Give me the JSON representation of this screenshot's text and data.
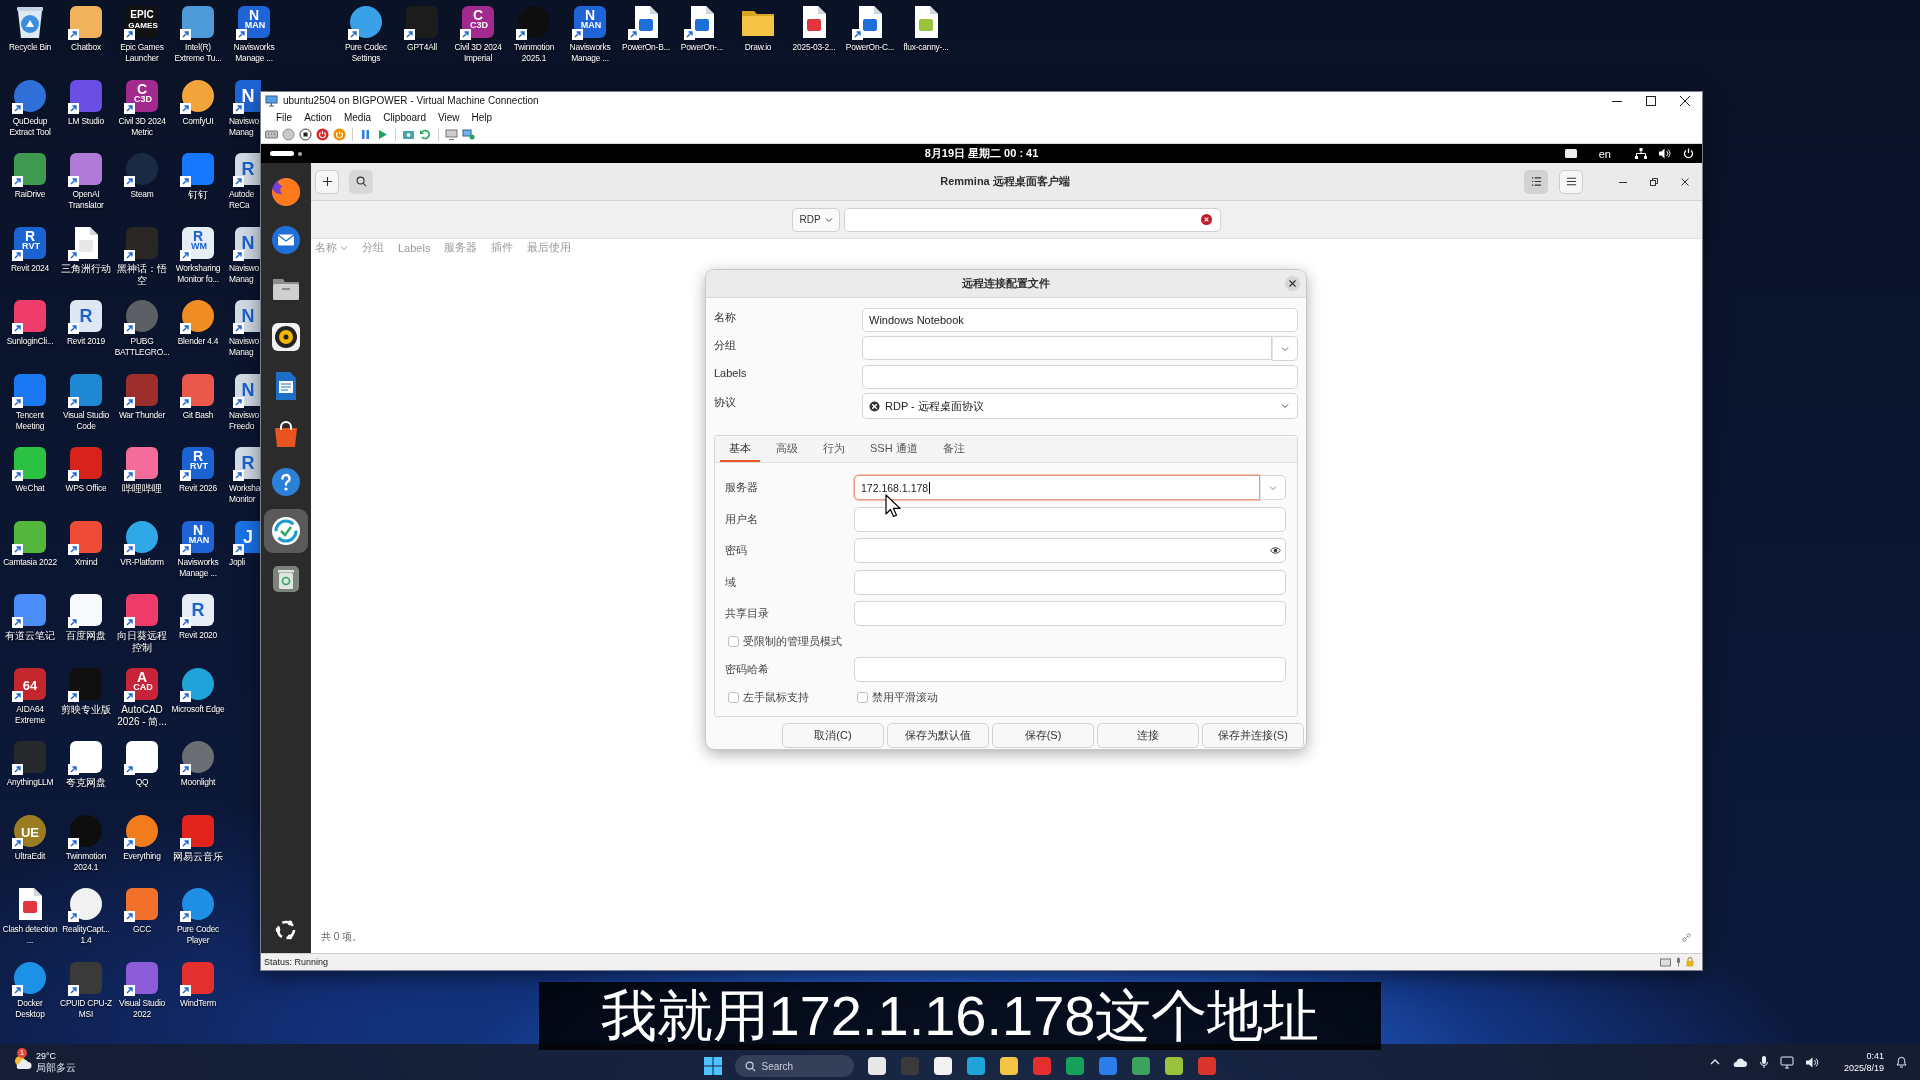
{
  "desktop": {
    "columns": [
      [
        {
          "label": "Recycle Bin",
          "kind": "bin",
          "color": "#3d8ee0",
          "shortcut": false
        },
        {
          "label": "QuDedup Extract Tool",
          "kind": "round",
          "color": "#2f6fd8",
          "shortcut": true
        },
        {
          "label": "RaiDrive",
          "kind": "tile",
          "color": "#3d9a4f",
          "shortcut": true
        },
        {
          "label": "Revit 2024",
          "kind": "tile",
          "color": "#1b63d1",
          "glyph": "R",
          "sub": "RVT",
          "shortcut": true
        },
        {
          "label": "SunloginCli...",
          "kind": "tile",
          "color": "#ef3d6b",
          "shortcut": true
        },
        {
          "label": "Tencent Meeting",
          "kind": "tile",
          "color": "#1a79f2",
          "shortcut": true
        },
        {
          "label": "WeChat",
          "kind": "tile",
          "color": "#2bc244",
          "shortcut": true
        },
        {
          "label": "Camtasia 2022",
          "kind": "tile",
          "color": "#55b63e",
          "shortcut": true
        },
        {
          "label": "有道云笔记",
          "kind": "tile",
          "color": "#4b8df8",
          "shortcut": true
        },
        {
          "label": "AIDA64 Extreme",
          "kind": "tile",
          "color": "#c4262e",
          "glyph": "64",
          "shortcut": true
        },
        {
          "label": "AnythingLLM",
          "kind": "tile",
          "color": "#26282c",
          "shortcut": true
        },
        {
          "label": "UltraEdit",
          "kind": "round",
          "color": "#9a7d22",
          "glyph": "UE",
          "shortcut": true
        },
        {
          "label": "Clash detection ...",
          "kind": "doc",
          "color": "#e2353f",
          "shortcut": false
        },
        {
          "label": "Docker Desktop",
          "kind": "round",
          "color": "#1d91e6",
          "shortcut": true
        }
      ],
      [
        {
          "label": "Chatbox",
          "kind": "tile",
          "color": "#f2b35e",
          "shortcut": true
        },
        {
          "label": "LM Studio",
          "kind": "tile",
          "color": "#6a4de3",
          "shortcut": true
        },
        {
          "label": "OpenAI Translator",
          "kind": "tile",
          "color": "#b07ad8",
          "shortcut": true
        },
        {
          "label": "三角洲行动",
          "kind": "doc",
          "color": "#e8e8e8",
          "shortcut": true
        },
        {
          "label": "Revit 2019",
          "kind": "tile",
          "color": "#dfe8f2",
          "glyph": "R",
          "shortcut": true
        },
        {
          "label": "Visual Studio Code",
          "kind": "tile",
          "color": "#1e88d4",
          "shortcut": true
        },
        {
          "label": "WPS Office",
          "kind": "tile",
          "color": "#d8231c",
          "shortcut": true
        },
        {
          "label": "Xmind",
          "kind": "tile",
          "color": "#f04b36",
          "shortcut": true
        },
        {
          "label": "百度网盘",
          "kind": "tile",
          "color": "#f7f9fc",
          "shortcut": true
        },
        {
          "label": "剪映专业版",
          "kind": "tile",
          "color": "#101010",
          "shortcut": true
        },
        {
          "label": "夸克网盘",
          "kind": "tile",
          "color": "#ffffff",
          "shortcut": true
        },
        {
          "label": "Twinmotion 2024.1",
          "kind": "round",
          "color": "#0e0e0e",
          "shortcut": true
        },
        {
          "label": "RealityCapt... 1.4",
          "kind": "round",
          "color": "#f2f2f2",
          "shortcut": true
        },
        {
          "label": "CPUID CPU-Z MSI",
          "kind": "tile",
          "color": "#3a3a3a",
          "shortcut": true
        }
      ],
      [
        {
          "label": "Epic Games Launcher",
          "kind": "tile",
          "color": "#121212",
          "glyph": "EPIC",
          "sub": "GAMES",
          "shortcut": true
        },
        {
          "label": "Civil 3D 2024 Metric",
          "kind": "tile",
          "color": "#a22a8e",
          "glyph": "C",
          "sub": "C3D",
          "shortcut": true
        },
        {
          "label": "Steam",
          "kind": "round",
          "color": "#1b2a44",
          "shortcut": true
        },
        {
          "label": "黑神话：悟空",
          "kind": "tile",
          "color": "#2a2624",
          "shortcut": true
        },
        {
          "label": "PUBG BATTLEGRO...",
          "kind": "round",
          "color": "#5b5e62",
          "shortcut": true
        },
        {
          "label": "War Thunder",
          "kind": "tile",
          "color": "#9c2f2b",
          "shortcut": true
        },
        {
          "label": "哔哩哔哩",
          "kind": "tile",
          "color": "#f46d9a",
          "shortcut": true
        },
        {
          "label": "VR-Platform",
          "kind": "round",
          "color": "#2ea8e6",
          "shortcut": true
        },
        {
          "label": "向日葵远程控制",
          "kind": "tile",
          "color": "#f03c6b",
          "shortcut": true
        },
        {
          "label": "AutoCAD 2026 - 简...",
          "kind": "tile",
          "color": "#c7243a",
          "glyph": "A",
          "sub": "CAD",
          "shortcut": true
        },
        {
          "label": "QQ",
          "kind": "tile",
          "color": "#ffffff",
          "shortcut": true
        },
        {
          "label": "Everything",
          "kind": "round",
          "color": "#f27c1c",
          "shortcut": true
        },
        {
          "label": "GCC",
          "kind": "tile",
          "color": "#f3702a",
          "shortcut": true
        },
        {
          "label": "Visual Studio 2022",
          "kind": "tile",
          "color": "#8c5bd8",
          "shortcut": true
        }
      ],
      [
        {
          "label": "Intel(R) Extreme Tu...",
          "kind": "tile",
          "color": "#4f9ad8",
          "shortcut": true
        },
        {
          "label": "ComfyUI",
          "kind": "round",
          "color": "#f2a33a",
          "shortcut": true
        },
        {
          "label": "钉钉",
          "kind": "tile",
          "color": "#1677ff",
          "shortcut": true
        },
        {
          "label": "Worksharing Monitor fo...",
          "kind": "tile",
          "color": "#e6edf5",
          "glyph": "R",
          "sub": "WM",
          "shortcut": true
        },
        {
          "label": "Blender 4.4",
          "kind": "round",
          "color": "#f08c24",
          "shortcut": true
        },
        {
          "label": "Git Bash",
          "kind": "tile",
          "color": "#e9584b",
          "shortcut": true
        },
        {
          "label": "Revit 2026",
          "kind": "tile",
          "color": "#1b63d1",
          "glyph": "R",
          "sub": "RVT",
          "shortcut": true
        },
        {
          "label": "Navisworks Manage ...",
          "kind": "tile",
          "color": "#1f64d6",
          "glyph": "N",
          "sub": "MAN",
          "shortcut": true
        },
        {
          "label": "Revit 2020",
          "kind": "tile",
          "color": "#e6edf5",
          "glyph": "R",
          "shortcut": true
        },
        {
          "label": "Microsoft Edge",
          "kind": "round",
          "color": "#1fa3d9",
          "shortcut": true
        },
        {
          "label": "Moonlight",
          "kind": "round",
          "color": "#6b6e72",
          "shortcut": true
        },
        {
          "label": "网易云音乐",
          "kind": "tile",
          "color": "#e3241d",
          "shortcut": true
        },
        {
          "label": "Pure Codec Player",
          "kind": "round",
          "color": "#1e8fe3",
          "shortcut": true
        },
        {
          "label": "WindTerm",
          "kind": "tile",
          "color": "#e3302f",
          "shortcut": true
        }
      ],
      [
        {
          "label": "Navisworks Manage ...",
          "kind": "tile",
          "color": "#1f64d6",
          "glyph": "N",
          "sub": "MAN",
          "shortcut": true
        },
        {
          "label": "Naviswo Manag",
          "kind": "tile",
          "color": "#1f64d6",
          "glyph": "N",
          "shortcut": true
        },
        {
          "label": "Autode ReCa",
          "kind": "tile",
          "color": "#d3dde8",
          "glyph": "R",
          "shortcut": true
        },
        {
          "label": "Naviswo Manag",
          "kind": "tile",
          "color": "#d3dde8",
          "glyph": "N",
          "shortcut": true
        },
        {
          "label": "Naviswo Manag",
          "kind": "tile",
          "color": "#d3dde8",
          "glyph": "N",
          "shortcut": true
        },
        {
          "label": "Naviswo Freedo",
          "kind": "tile",
          "color": "#d3dde8",
          "glyph": "N",
          "shortcut": true
        },
        {
          "label": "Worksha Monitor",
          "kind": "tile",
          "color": "#d3dde8",
          "glyph": "R",
          "shortcut": true
        },
        {
          "label": "Jopli",
          "kind": "tile",
          "color": "#1a73e8",
          "glyph": "J",
          "shortcut": true
        }
      ]
    ],
    "top_row": [
      {
        "label": "Pure Codec Settings",
        "kind": "round",
        "color": "#3aa0e8",
        "shortcut": true
      },
      {
        "label": "GPT4All",
        "kind": "tile",
        "color": "#1c1c1c",
        "shortcut": true
      },
      {
        "label": "Civil 3D 2024 Imperial",
        "kind": "tile",
        "color": "#a22a8e",
        "glyph": "C",
        "sub": "C3D",
        "shortcut": true
      },
      {
        "label": "Twinmotion 2025.1",
        "kind": "round",
        "color": "#0e0e0e",
        "shortcut": true
      },
      {
        "label": "Navisworks Manage ...",
        "kind": "tile",
        "color": "#1f64d6",
        "glyph": "N",
        "sub": "MAN",
        "shortcut": true
      },
      {
        "label": "PowerOn-B...",
        "kind": "doc",
        "color": "#1f6fd9",
        "shortcut": true
      },
      {
        "label": "PowerOn-...",
        "kind": "doc",
        "color": "#1f6fd9",
        "shortcut": true
      },
      {
        "label": "Draw.io",
        "kind": "folder",
        "color": "#f5c445",
        "shortcut": false
      },
      {
        "label": "2025-03-2...",
        "kind": "doc",
        "color": "#e2353f",
        "shortcut": false
      },
      {
        "label": "PowerOn-C...",
        "kind": "doc",
        "color": "#1f6fd9",
        "shortcut": true
      },
      {
        "label": "flux-canny-...",
        "kind": "doc",
        "color": "#9ac23c",
        "shortcut": false
      }
    ]
  },
  "vm_window": {
    "title": "ubuntu2504 on BIGPOWER - Virtual Machine Connection",
    "menu": [
      "File",
      "Action",
      "Media",
      "Clipboard",
      "View",
      "Help"
    ],
    "status": "Status: Running"
  },
  "ubuntu": {
    "clock": "8月19日 星期二 00 : 41",
    "input_method": "en",
    "dock": [
      {
        "kind": "browser",
        "selected": false
      },
      {
        "kind": "mail",
        "selected": false
      },
      {
        "kind": "files",
        "selected": false
      },
      {
        "kind": "music",
        "selected": false
      },
      {
        "kind": "writer",
        "selected": false
      },
      {
        "kind": "store",
        "selected": false
      },
      {
        "kind": "help",
        "selected": false
      },
      {
        "kind": "remote",
        "selected": true
      },
      {
        "kind": "trash",
        "selected": false
      }
    ]
  },
  "remmina": {
    "title": "Remmina 远程桌面客户端",
    "list_view": true,
    "protocol_filter": "RDP",
    "columns": [
      {
        "label": "名称",
        "sorted": true
      },
      {
        "label": "分组",
        "sorted": false
      },
      {
        "label": "Labels",
        "sorted": false
      },
      {
        "label": "服务器",
        "sorted": false
      },
      {
        "label": "插件",
        "sorted": false
      },
      {
        "label": "最后使用",
        "sorted": false
      }
    ],
    "item_count": "共 0 项。"
  },
  "dialog": {
    "title": "远程连接配置文件",
    "profile": [
      {
        "label": "名称",
        "kind": "entry",
        "value": "Windows Notebook"
      },
      {
        "label": "分组",
        "kind": "combo"
      },
      {
        "label": "Labels",
        "kind": "entry"
      },
      {
        "label": "协议",
        "kind": "protocol",
        "value": "RDP - 远程桌面协议"
      }
    ],
    "tabs": [
      {
        "label": "基本",
        "selected": true
      },
      {
        "label": "高级",
        "selected": false
      },
      {
        "label": "行为",
        "selected": false
      },
      {
        "label": "SSH 通道",
        "selected": false
      },
      {
        "label": "备注",
        "selected": false
      }
    ],
    "basic": {
      "fields": [
        {
          "label": "服务器",
          "kind": "combo",
          "value": "172.168.1.178",
          "focused": true
        },
        {
          "label": "用户名",
          "kind": "entry",
          "focused": false
        },
        {
          "label": "密码",
          "kind": "password",
          "focused": false
        },
        {
          "label": "域",
          "kind": "entry",
          "focused": false
        },
        {
          "label": "共享目录",
          "kind": "entry",
          "focused": false
        }
      ],
      "restricted_admin": {
        "label": "受限制的管理员模式",
        "checked": false
      },
      "hash_field": {
        "label": "密码哈希"
      },
      "checks": [
        {
          "label": "左手鼠标支持",
          "checked": false
        },
        {
          "label": "禁用平滑滚动",
          "checked": false
        }
      ]
    },
    "buttons": [
      "取消(C)",
      "保存为默认值",
      "保存(S)",
      "连接",
      "保存并连接(S)"
    ]
  },
  "subtitle": "我就用172.1.16.178这个地址",
  "taskbar": {
    "weather": {
      "badge": "1",
      "temperature": "29°C",
      "condition": "局部多云"
    },
    "search": {
      "placeholder": "Search"
    },
    "time": "0:41",
    "date": "2025/8/19"
  }
}
